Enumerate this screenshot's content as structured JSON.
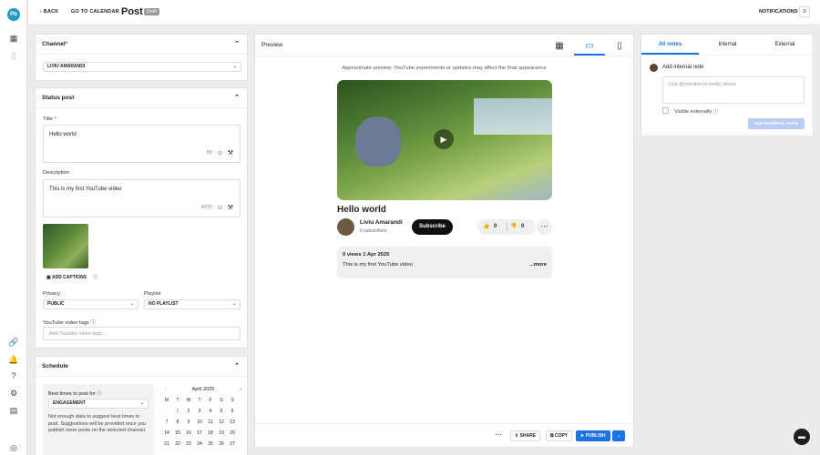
{
  "rail": {
    "logo": "Pb",
    "icons": [
      "apps-icon",
      "panel-icon",
      "link-icon",
      "notifications-icon",
      "help-icon",
      "settings-icon",
      "building-icon",
      "account-icon"
    ]
  },
  "topbar": {
    "back": "BACK",
    "go_to_calendar": "GO TO CALENDAR",
    "title": "Post",
    "badge": "Draft",
    "notifications": "NOTIFICATIONS",
    "notifications_count": "0"
  },
  "channel": {
    "header": "Channel",
    "required": "*",
    "value": "LIVIU AMARANDI"
  },
  "status_post": {
    "header": "Status post",
    "title_label": "Title",
    "title_required": "*",
    "title_value": "Hello world",
    "title_count": "89",
    "description_label": "Description",
    "description_value": "This is my first YouTube video",
    "description_count": "4970",
    "add_captions": "ADD CAPTIONS",
    "privacy_label": "Privacy",
    "privacy_value": "PUBLIC",
    "playlist_label": "Playlist",
    "playlist_value": "NO PLAYLIST",
    "tags_label": "YouTube video tags",
    "tags_placeholder": "Add Youtube video tags..."
  },
  "schedule": {
    "header": "Schedule",
    "best_times_label": "Best times to post for",
    "best_times_value": "ENGAGEMENT",
    "note": "Not enough data to suggest best times to post. Suggestions will be provided once you publish more posts on the selected channel.",
    "calendar": {
      "month": "April 2025",
      "weekdays": [
        "M",
        "T",
        "W",
        "T",
        "F",
        "S",
        "S"
      ],
      "weeks": [
        [
          "",
          "1",
          "2",
          "3",
          "4",
          "5",
          "6"
        ],
        [
          "7",
          "8",
          "9",
          "10",
          "11",
          "12",
          "13"
        ],
        [
          "14",
          "15",
          "16",
          "17",
          "18",
          "19",
          "20"
        ],
        [
          "21",
          "22",
          "23",
          "24",
          "25",
          "26",
          "27"
        ]
      ]
    }
  },
  "preview": {
    "header": "Preview",
    "note": "Approximate preview. YouTube experiments or updates may affect the final appearance",
    "video_title": "Hello world",
    "channel_name": "Liviu Amarandi",
    "subscribers": "0 subscribers",
    "subscribe": "Subscribe",
    "likes": "0",
    "dislikes": "0",
    "stats": "0 views  1 Apr 2025",
    "description": "This is my first YouTube video",
    "more": "...more",
    "share": "SHARE",
    "copy": "COPY",
    "publish": "PUBLISH"
  },
  "notes": {
    "tabs": [
      "All notes",
      "Internal",
      "External"
    ],
    "add_label": "Add internal note",
    "placeholder": "Use @mention to notify others",
    "visible_externally": "Visible externally",
    "add_button": "ADD INTERNAL NOTE"
  },
  "colors": {
    "accent": "#1a73e8",
    "logo": "#1f9bbf"
  }
}
